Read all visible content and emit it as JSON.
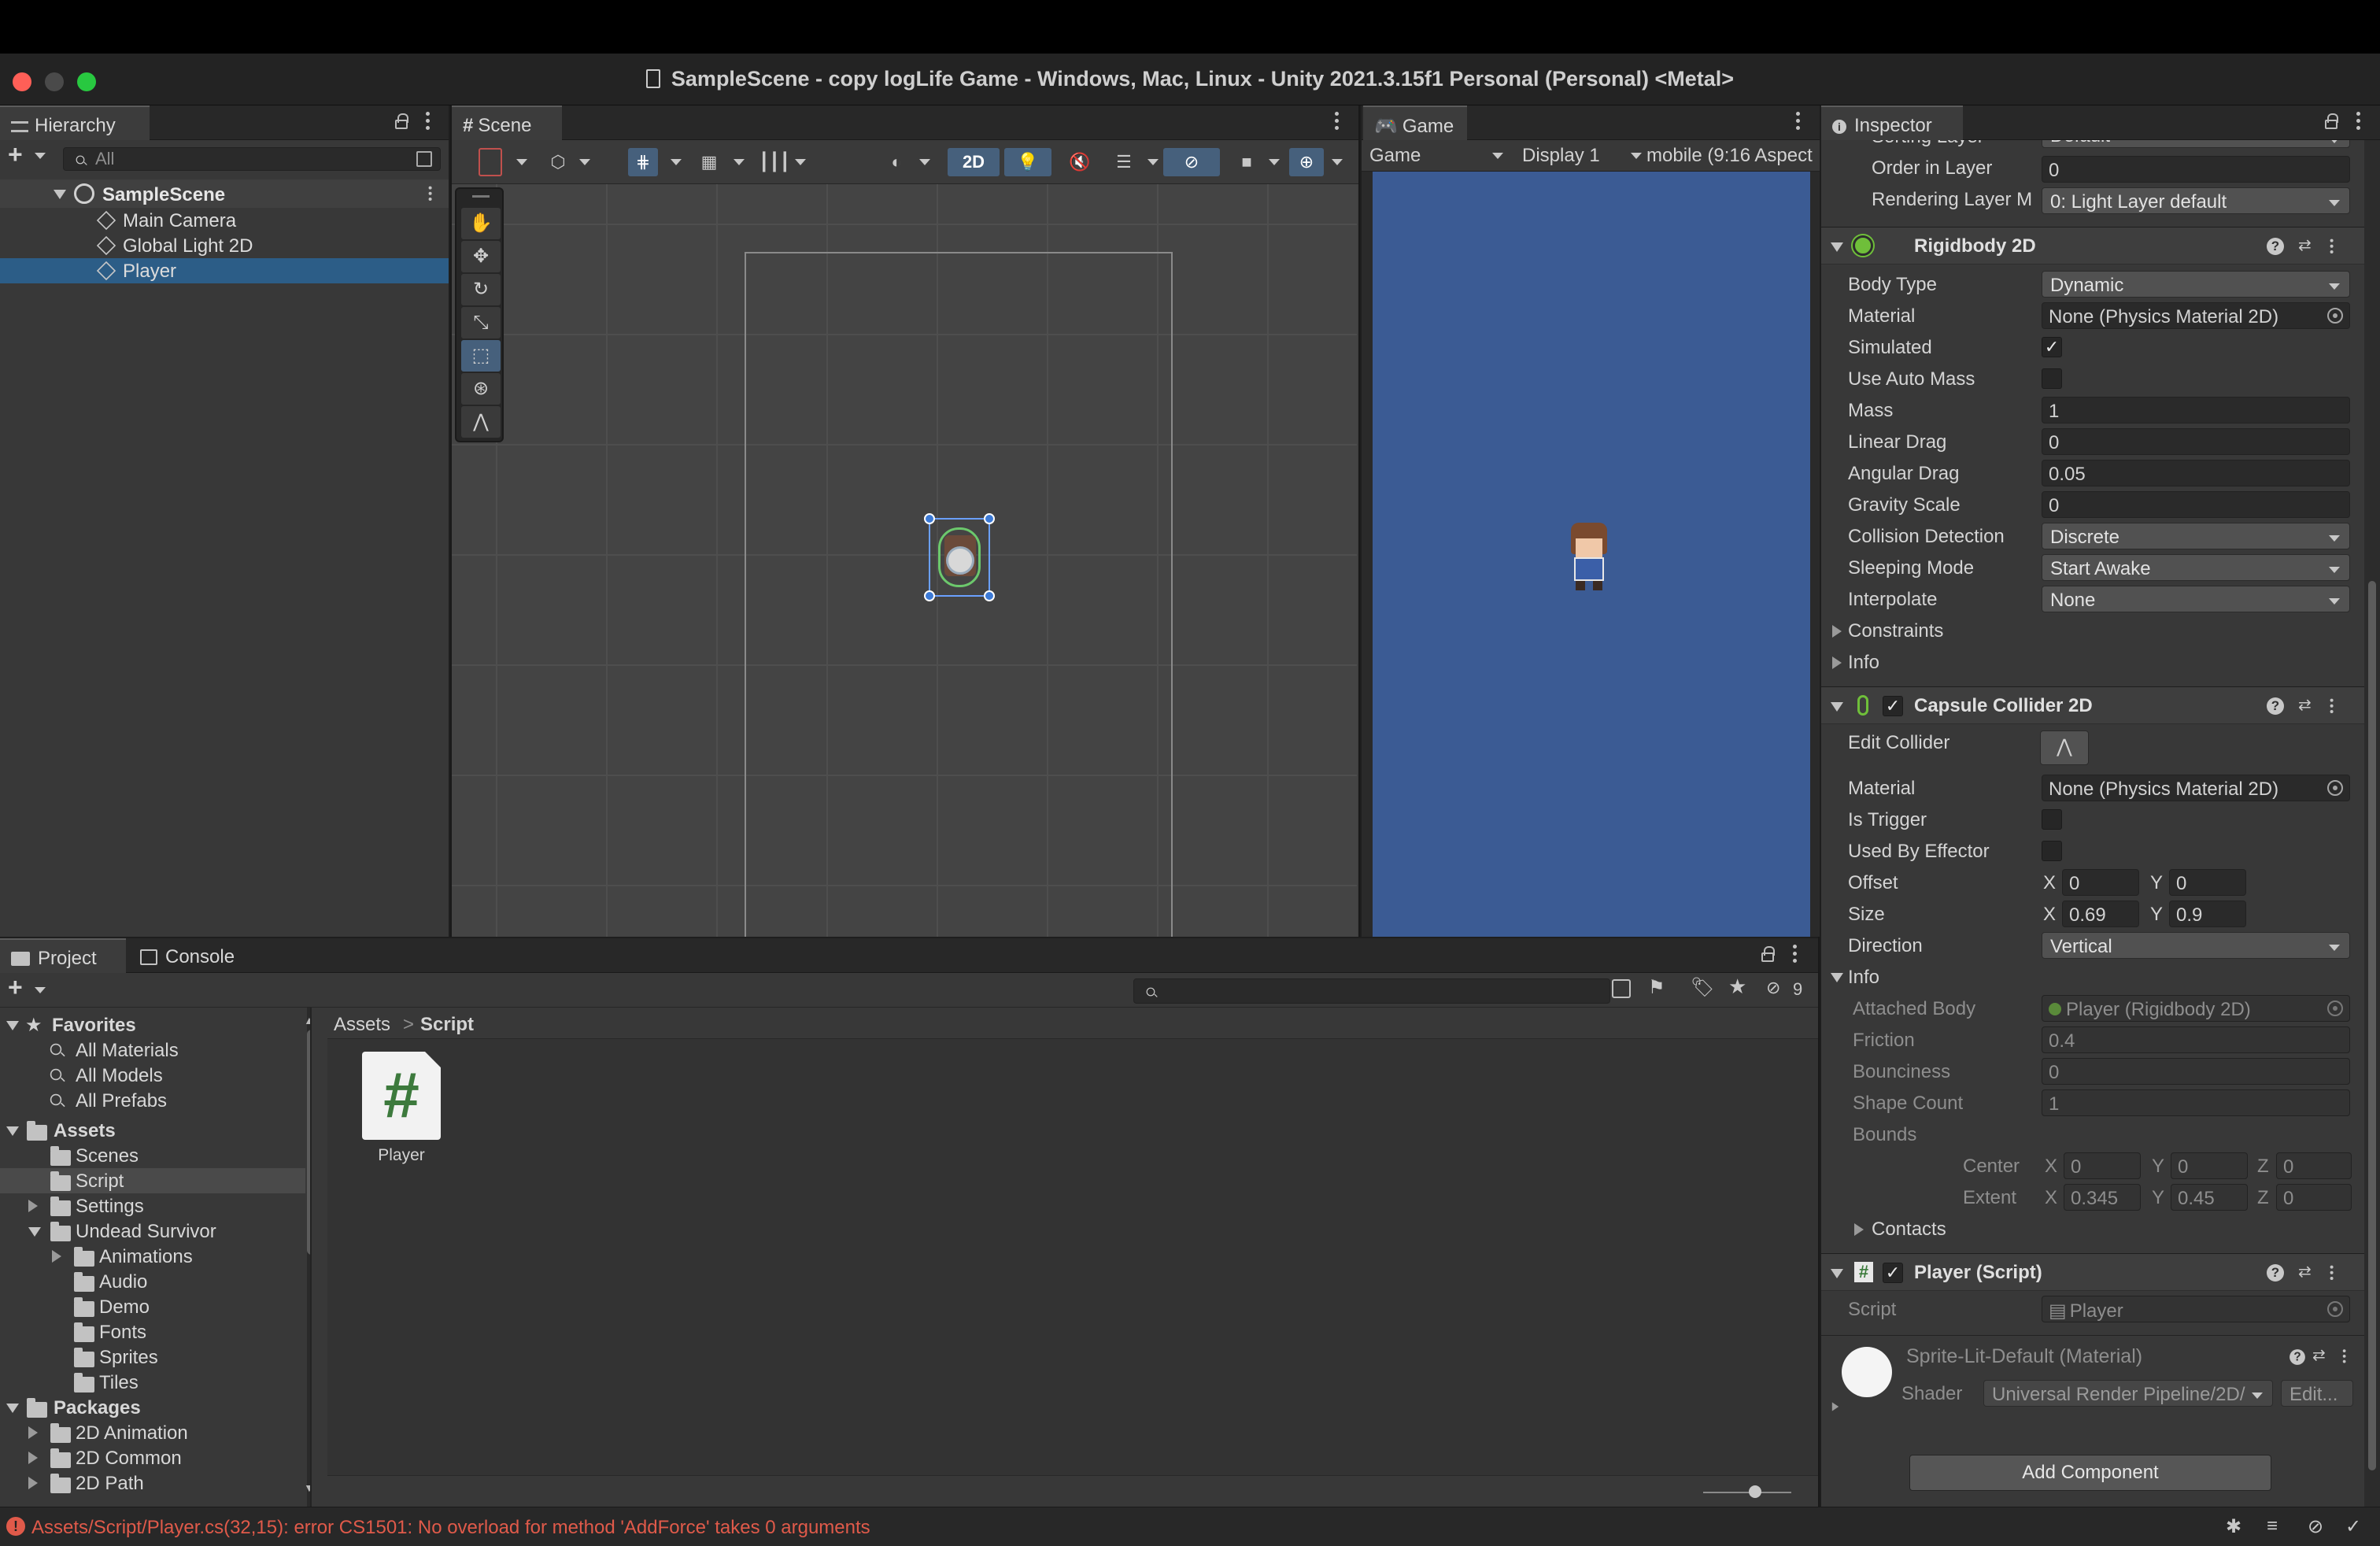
{
  "window": {
    "title": "SampleScene - copy logLife Game - Windows, Mac, Linux - Unity 2021.3.15f1 Personal (Personal) <Metal>"
  },
  "hierarchy": {
    "tab_label": "Hierarchy",
    "search_placeholder": "All",
    "scene_name": "SampleScene",
    "items": [
      {
        "label": "Main Camera",
        "selected": false
      },
      {
        "label": "Global Light 2D",
        "selected": false
      },
      {
        "label": "Player",
        "selected": true
      }
    ]
  },
  "scene_view": {
    "tab_label": "Scene",
    "toggle_2d": "2D"
  },
  "game_view": {
    "tab_label": "Game",
    "mode": "Game",
    "display": "Display 1",
    "aspect": "mobile (9:16 Aspect",
    "background_color": "#3b5b94"
  },
  "inspector": {
    "tab_label": "Inspector",
    "renderer": {
      "sorting_layer_label": "Sorting Layer",
      "sorting_layer_value": "Default",
      "order_label": "Order in Layer",
      "order_value": "0",
      "rendering_layer_label": "Rendering Layer M",
      "rendering_layer_value": "0: Light Layer default"
    },
    "rigidbody": {
      "title": "Rigidbody 2D",
      "fields": [
        {
          "label": "Body Type",
          "value": "Dynamic",
          "kind": "dropdown"
        },
        {
          "label": "Material",
          "value": "None (Physics Material 2D)",
          "kind": "object"
        },
        {
          "label": "Simulated",
          "value": "✓",
          "kind": "checkbox"
        },
        {
          "label": "Use Auto Mass",
          "value": "",
          "kind": "checkbox"
        },
        {
          "label": "Mass",
          "value": "1",
          "kind": "text"
        },
        {
          "label": "Linear Drag",
          "value": "0",
          "kind": "text"
        },
        {
          "label": "Angular Drag",
          "value": "0.05",
          "kind": "text"
        },
        {
          "label": "Gravity Scale",
          "value": "0",
          "kind": "text"
        },
        {
          "label": "Collision Detection",
          "value": "Discrete",
          "kind": "dropdown"
        },
        {
          "label": "Sleeping Mode",
          "value": "Start Awake",
          "kind": "dropdown"
        },
        {
          "label": "Interpolate",
          "value": "None",
          "kind": "dropdown"
        }
      ],
      "constraints_label": "Constraints",
      "info_label": "Info"
    },
    "capsule": {
      "title": "Capsule Collider 2D",
      "edit_collider_label": "Edit Collider",
      "material_label": "Material",
      "material_value": "None (Physics Material 2D)",
      "is_trigger_label": "Is Trigger",
      "used_by_effector_label": "Used By Effector",
      "offset_label": "Offset",
      "offset_x": "0",
      "offset_y": "0",
      "size_label": "Size",
      "size_x": "0.69",
      "size_y": "0.9",
      "direction_label": "Direction",
      "direction_value": "Vertical",
      "info_label": "Info",
      "attached_body_label": "Attached Body",
      "attached_body_value": "Player (Rigidbody 2D)",
      "friction_label": "Friction",
      "friction_value": "0.4",
      "bounciness_label": "Bounciness",
      "bounciness_value": "0",
      "shape_count_label": "Shape Count",
      "shape_count_value": "1",
      "bounds_label": "Bounds",
      "center_label": "Center",
      "center_x": "0",
      "center_y": "0",
      "center_z": "0",
      "extent_label": "Extent",
      "extent_x": "0.345",
      "extent_y": "0.45",
      "extent_z": "0",
      "contacts_label": "Contacts",
      "axis_x": "X",
      "axis_y": "Y",
      "axis_z": "Z"
    },
    "script": {
      "title": "Player (Script)",
      "script_label": "Script",
      "script_value": "Player"
    },
    "material": {
      "title": "Sprite-Lit-Default (Material)",
      "shader_label": "Shader",
      "shader_value": "Universal Render Pipeline/2D/",
      "edit_label": "Edit..."
    },
    "add_component_label": "Add Component"
  },
  "project": {
    "tab_project": "Project",
    "tab_console": "Console",
    "hidden_count": "9",
    "favorites_label": "Favorites",
    "favorites": [
      "All Materials",
      "All Models",
      "All Prefabs"
    ],
    "assets_label": "Assets",
    "assets_tree": [
      {
        "label": "Scenes",
        "level": 1,
        "expandable": false,
        "selected": false
      },
      {
        "label": "Script",
        "level": 1,
        "expandable": false,
        "selected": true
      },
      {
        "label": "Settings",
        "level": 1,
        "expandable": true,
        "selected": false
      },
      {
        "label": "Undead Survivor",
        "level": 1,
        "expandable": true,
        "selected": false,
        "open": true
      },
      {
        "label": "Animations",
        "level": 2,
        "expandable": true,
        "selected": false
      },
      {
        "label": "Audio",
        "level": 2,
        "expandable": false,
        "selected": false
      },
      {
        "label": "Demo",
        "level": 2,
        "expandable": false,
        "selected": false
      },
      {
        "label": "Fonts",
        "level": 2,
        "expandable": false,
        "selected": false
      },
      {
        "label": "Sprites",
        "level": 2,
        "expandable": false,
        "selected": false
      },
      {
        "label": "Tiles",
        "level": 2,
        "expandable": false,
        "selected": false
      }
    ],
    "packages_label": "Packages",
    "packages_tree": [
      "2D Animation",
      "2D Common",
      "2D Path"
    ],
    "breadcrumb": [
      "Assets",
      "Script"
    ],
    "breadcrumb_sep": ">",
    "files": [
      {
        "name": "Player",
        "glyph": "#"
      }
    ]
  },
  "status": {
    "error_message": "Assets/Script/Player.cs(32,15): error CS1501: No overload for method 'AddForce' takes 0 arguments",
    "error_color": "#e05a4a"
  }
}
